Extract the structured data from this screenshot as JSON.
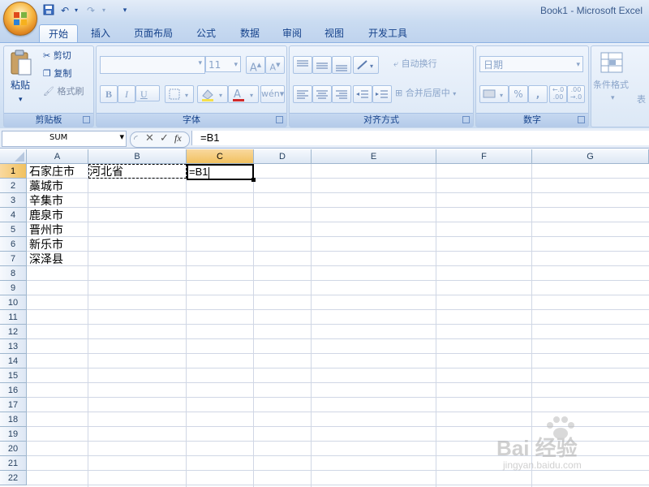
{
  "window": {
    "title": "Book1 - Microsoft Excel"
  },
  "tabs": [
    "开始",
    "插入",
    "页面布局",
    "公式",
    "数据",
    "审阅",
    "视图",
    "开发工具"
  ],
  "ribbon": {
    "clipboard": {
      "label": "剪贴板",
      "paste": "粘贴",
      "cut": "剪切",
      "copy": "复制",
      "format_painter": "格式刷"
    },
    "font": {
      "label": "字体",
      "font_name": "",
      "font_size": "11",
      "bold": "B",
      "italic": "I",
      "underline": "U"
    },
    "alignment": {
      "label": "对齐方式",
      "wrap_text": "自动换行",
      "merge_center": "合并后居中"
    },
    "number": {
      "label": "数字",
      "format": "日期",
      "percent": "%",
      "comma": ","
    },
    "styles": {
      "conditional_format": "条件格式",
      "table_partial": "表"
    }
  },
  "formula_bar": {
    "name_box": "SUM",
    "fx": "fx",
    "formula": "=B1"
  },
  "columns": [
    "A",
    "B",
    "C",
    "D",
    "E",
    "F",
    "G"
  ],
  "rows": [
    "1",
    "2",
    "3",
    "4",
    "5",
    "6",
    "7",
    "8",
    "9",
    "10",
    "11",
    "12",
    "13",
    "14",
    "15",
    "16",
    "17",
    "18",
    "19",
    "20",
    "21",
    "22"
  ],
  "cells": {
    "A1": "石家庄市",
    "A2": "藁城市",
    "A3": "辛集市",
    "A4": "鹿泉市",
    "A5": "晋州市",
    "A6": "新乐市",
    "A7": "深泽县",
    "B1": "河北省",
    "C1": "=B1"
  },
  "watermark": {
    "line1": "Bai 经验",
    "line2": "jingyan.baidu.com"
  },
  "colors": {
    "accent": "#15428b",
    "selected_header": "#f1c15f",
    "gridline": "#d0d7e5"
  }
}
